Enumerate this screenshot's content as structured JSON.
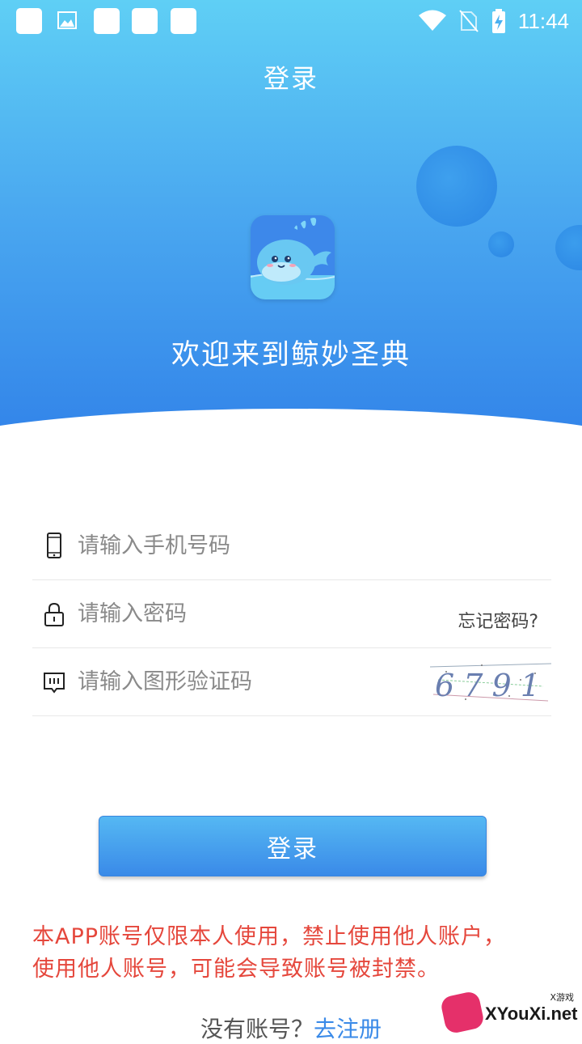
{
  "status_bar": {
    "time": "11:44"
  },
  "header": {
    "title": "登录",
    "welcome": "欢迎来到鲸妙圣典"
  },
  "form": {
    "phone_placeholder": "请输入手机号码",
    "password_placeholder": "请输入密码",
    "forgot_label": "忘记密码?",
    "captcha_placeholder": "请输入图形验证码",
    "captcha_text": "6791"
  },
  "login_button": "登录",
  "notice": {
    "line1": "本APP账号仅限本人使用，禁止使用他人账户，",
    "line2": "使用他人账号，可能会导致账号被封禁。"
  },
  "register": {
    "prompt": "没有账号？",
    "link": "去注册"
  },
  "watermark": {
    "text": "XYouXi.net",
    "small": "X游戏"
  },
  "colors": {
    "header_top": "#5fcff5",
    "header_bottom": "#2f7fe8",
    "button": "#3a8ae8",
    "notice": "#e5473c",
    "link": "#3a8ae8"
  }
}
